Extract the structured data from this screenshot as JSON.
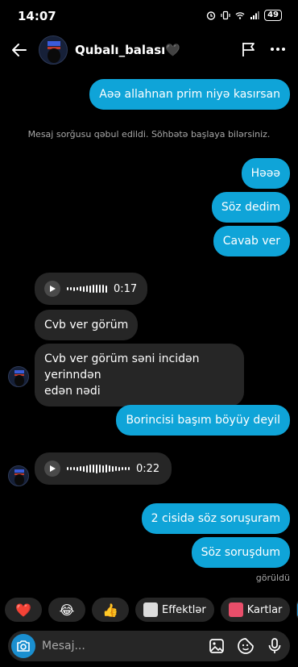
{
  "status": {
    "time": "14:07",
    "battery": "49"
  },
  "header": {
    "username": "Qubalı_balası🖤"
  },
  "system_message": "Mesaj sorğusu qəbul edildi. Söhbətə başlaya bilərsiniz.",
  "messages": [
    {
      "text": "Aəə allahnan prim niyə kasırsan"
    },
    {
      "text": "Həəə"
    },
    {
      "text": "Söz dedim"
    },
    {
      "text": "Cavab ver"
    },
    {
      "duration": "0:17"
    },
    {
      "text": "Cvb ver görüm"
    },
    {
      "line1": "Cvb  ver görüm səni incidən yerinndən",
      "line2": "edən nədi"
    },
    {
      "text": "Borincisi başım böyüy deyil"
    },
    {
      "duration": "0:22"
    },
    {
      "text": "2 cisidə söz soruşuram"
    },
    {
      "text": "Söz soruşdum"
    }
  ],
  "seen_label": "görüldü",
  "reactions": {
    "heart": "❤️",
    "laugh": "😂",
    "thumbs": "👍",
    "effects_label": "Effektlər",
    "cards_label": "Kartlar"
  },
  "composer": {
    "placeholder": "Mesaj..."
  },
  "colors": {
    "outgoing": "#0fa4d8",
    "incoming": "#262626",
    "background": "#000000"
  }
}
